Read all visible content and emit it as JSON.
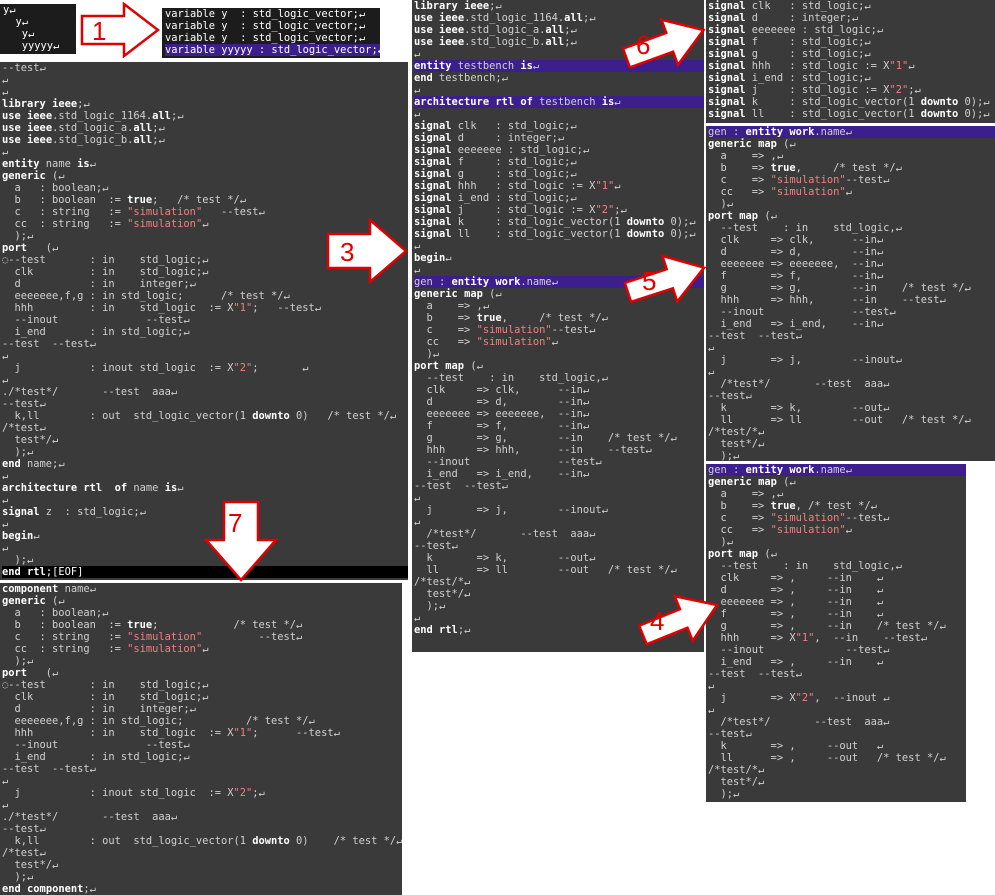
{
  "labels": {
    "one": "1",
    "three": "3",
    "four": "4",
    "five": "5",
    "six": "6",
    "seven": "7"
  },
  "pane_top_small": [
    "y↵",
    "  y↵",
    "   y↵",
    "   yyyyy↵"
  ],
  "pane_variables": [
    "variable y  : std_logic_vector;↵",
    "variable y  : std_logic_vector;↵",
    "variable y  : std_logic_vector;↵",
    "variable yyyyy : std_logic_vector;↵"
  ],
  "pane_left_main": [
    "--test↵",
    "↵",
    "↵",
    "library ieee;↵",
    "use ieee.std_logic_1164.all;↵",
    "use ieee.std_logic_a.all;↵",
    "use ieee.std_logic_b.all;↵",
    "↵",
    "entity name is↵",
    "generic (↵",
    "  a   : boolean;↵",
    "  b   : boolean  := true;   /* test */↵",
    "  c   : string   := \"simulation\"   --test↵",
    "  cc  : string   := \"simulation\"↵",
    "  );↵",
    "port   (↵",
    "◌--test       : in    std_logic;↵",
    "  clk         : in    std_logic;↵",
    "  d           : in    integer;↵",
    "  eeeeeee,f,g : in std_logic;      /* test */↵",
    "  hhh         : in    std_logic  := X\"1\";   --test↵",
    "  --inout              --test↵",
    "  i_end       : in std_logic;↵",
    "--test  --test↵",
    "↵",
    "  j           : inout std_logic  := X\"2\";       ↵",
    "↵",
    "./*test*/       --test  aaa↵",
    "--test↵",
    "  k,ll        : out  std_logic_vector(1 downto 0)   /* test */↵",
    "/*test↵",
    "  test*/↵",
    "  );↵",
    "end name;↵",
    "↵",
    "architecture rtl  of name is↵",
    "↵",
    "signal z  : std_logic;↵",
    "↵",
    "begin↵",
    "↵",
    "  );↵",
    "end rtl;[EOF]"
  ],
  "pane_left_bottom": [
    "component name↵",
    "generic (↵",
    "  a   : boolean;↵",
    "  b   : boolean  := true;            /* test */↵",
    "  c   : string   := \"simulation\"         --test↵",
    "  cc  : string   := \"simulation\"↵",
    "  );↵",
    "port   (↵",
    "◌--test       : in    std_logic;↵",
    "  clk         : in    std_logic;↵",
    "  d           : in    integer;↵",
    "  eeeeeee,f,g : in std_logic;          /* test */↵",
    "  hhh         : in    std_logic  := X\"1\";      --test↵",
    "  --inout              --test↵",
    "  i_end       : in std_logic;↵",
    "--test  --test↵",
    "↵",
    "  j           : inout std_logic  := X\"2\";↵",
    "↵",
    "./*test*/       --test  aaa↵",
    "--test↵",
    "  k,ll        : out  std_logic_vector(1 downto 0)    /* test */↵",
    "/*test↵",
    "  test*/↵",
    "  );↵",
    "end component;↵"
  ],
  "pane_middle": [
    "library ieee;↵",
    "use ieee.std_logic_1164.all;↵",
    "use ieee.std_logic_a.all;↵",
    "use ieee.std_logic_b.all;↵",
    "↵",
    "entity testbench is↵",
    "end testbench;↵",
    "↵",
    "architecture rtl of testbench is↵",
    "↵",
    "signal clk   : std_logic;↵",
    "signal d     : integer;↵",
    "signal eeeeeee : std_logic;↵",
    "signal f     : std_logic;↵",
    "signal g     : std_logic;↵",
    "signal hhh   : std_logic := X\"1\"↵",
    "signal i_end : std_logic;↵",
    "signal j     : std_logic := X\"2\";↵",
    "signal k     : std_logic_vector(1 downto 0);↵",
    "signal ll    : std_logic_vector(1 downto 0);↵",
    "↵",
    "begin↵",
    "↵",
    "gen : entity work.name↵",
    "generic map (↵",
    "  a    => ,↵",
    "  b    => true,     /* test */↵",
    "  c    => \"simulation\"--test↵",
    "  cc   => \"simulation\"↵",
    "  )↵",
    "port map (↵",
    "  --test    : in    std_logic,↵",
    "  clk     => clk,      --in↵",
    "  d       => d,        --in↵",
    "  eeeeeee => eeeeeee,  --in↵",
    "  f       => f,        --in↵",
    "  g       => g,        --in    /* test */↵",
    "  hhh     => hhh,      --in    --test↵",
    "  --inout              --test↵",
    "  i_end   => i_end,    --in↵",
    "--test  --test↵",
    "↵",
    "  j       => j,        --inout↵",
    "↵",
    "  /*test*/       --test  aaa↵",
    "--test↵",
    "  k       => k,        --out↵",
    "  ll      => ll        --out   /* test */↵",
    "/*test/*↵",
    "  test*/↵",
    "  );↵",
    "↵",
    "end rtl;↵"
  ],
  "pane_right_top": [
    "signal clk   : std_logic;↵",
    "signal d     : integer;↵",
    "signal eeeeeee : std_logic;↵",
    "signal f     : std_logic;↵",
    "signal g     : std_logic;↵",
    "signal hhh   : std_logic := X\"1\"↵",
    "signal i_end : std_logic;↵",
    "signal j     : std_logic := X\"2\";↵",
    "signal k     : std_logic_vector(1 downto 0);↵",
    "signal ll    : std_logic_vector(1 downto 0);↵"
  ],
  "pane_right_mid": [
    "gen : entity work.name↵",
    "generic map (↵",
    "  a    => ,↵",
    "  b    => true,     /* test */↵",
    "  c    => \"simulation\"--test↵",
    "  cc   => \"simulation\"↵",
    "  )↵",
    "port map (↵",
    "  --test    : in    std_logic,↵",
    "  clk     => clk,      --in↵",
    "  d       => d,        --in↵",
    "  eeeeeee => eeeeeee,  --in↵",
    "  f       => f,        --in↵",
    "  g       => g,        --in    /* test */↵",
    "  hhh     => hhh,      --in    --test↵",
    "  --inout              --test↵",
    "  i_end   => i_end,    --in↵",
    "--test  --test↵",
    "↵",
    "  j       => j,        --inout↵",
    "↵",
    "  /*test*/       --test  aaa↵",
    "--test↵",
    "  k       => k,        --out↵",
    "  ll      => ll        --out   /* test */↵",
    "/*test/*↵",
    "  test*/↵",
    "  );↵"
  ],
  "pane_right_bottom": [
    "gen : entity work.name↵",
    "generic map (↵",
    "  a    => ,↵",
    "  b    => true, /* test */↵",
    "  c    => \"simulation\"--test↵",
    "  cc   => \"simulation\"↵",
    "  )↵",
    "port map (↵",
    "  --test    : in    std_logic,↵",
    "  clk     => ,     --in    ↵",
    "  d       => ,     --in    ↵",
    "  eeeeeee => ,     --in    ↵",
    "  f       => ,     --in    ↵",
    "  g       => ,     --in    /* test */↵",
    "  hhh     => X\"1\",  --in    --test↵",
    "  --inout             --test↵",
    "  i_end   => ,     --in    ↵",
    "--test  --test↵",
    "↵",
    "  j       => X\"2\",  --inout ↵",
    "↵",
    "  /*test*/       --test  aaa↵",
    "--test↵",
    "  k       => ,     --out   ↵",
    "  ll      => ,     --out   /* test */↵",
    "/*test/*↵",
    "  test*/↵",
    "  );↵"
  ],
  "colors": {
    "pane_bg": "#3a3a3a",
    "highlight": "#3c1e8c",
    "arrow_fill": "#ffffff",
    "arrow_stroke": "#e00000",
    "label": "#e00000"
  }
}
